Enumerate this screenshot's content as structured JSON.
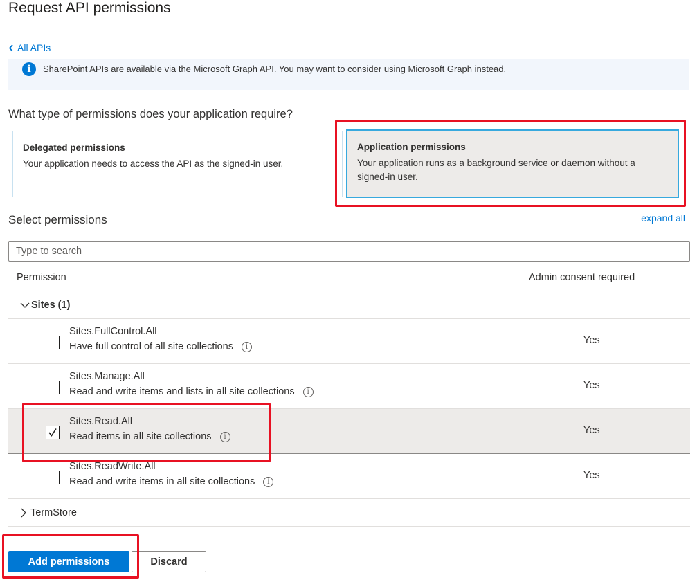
{
  "page": {
    "title": "Request API permissions"
  },
  "back_link": {
    "label": "All APIs"
  },
  "info_bar": {
    "text": "SharePoint APIs are available via the Microsoft Graph API.  You may want to consider using Microsoft Graph instead."
  },
  "permission_type": {
    "question": "What type of permissions does your application require?",
    "delegated": {
      "title": "Delegated permissions",
      "description": "Your application needs to access the API as the signed-in user."
    },
    "application": {
      "title": "Application permissions",
      "description": "Your application runs as a background service or daemon without a signed-in user.",
      "selected": true
    }
  },
  "select_permissions": {
    "title": "Select permissions",
    "expand_all": "expand all",
    "search_placeholder": "Type to search"
  },
  "table": {
    "columns": [
      "Permission",
      "Admin consent required"
    ],
    "groups": [
      {
        "label": "Sites (1)",
        "expanded": true,
        "items": [
          {
            "name": "Sites.FullControl.All",
            "description": "Have full control of all site collections",
            "admin_consent": "Yes",
            "checked": false
          },
          {
            "name": "Sites.Manage.All",
            "description": "Read and write items and lists in all site collections",
            "admin_consent": "Yes",
            "checked": false
          },
          {
            "name": "Sites.Read.All",
            "description": "Read items in all site collections",
            "admin_consent": "Yes",
            "checked": true
          },
          {
            "name": "Sites.ReadWrite.All",
            "description": "Read and write items in all site collections",
            "admin_consent": "Yes",
            "checked": false
          }
        ]
      },
      {
        "label": "TermStore",
        "expanded": false,
        "items": []
      }
    ]
  },
  "footer": {
    "add_button": "Add permissions",
    "discard_button": "Discard"
  },
  "colors": {
    "accent": "#0078d4",
    "highlight_annotation": "#e81123",
    "selected_bg": "#edebe9"
  }
}
